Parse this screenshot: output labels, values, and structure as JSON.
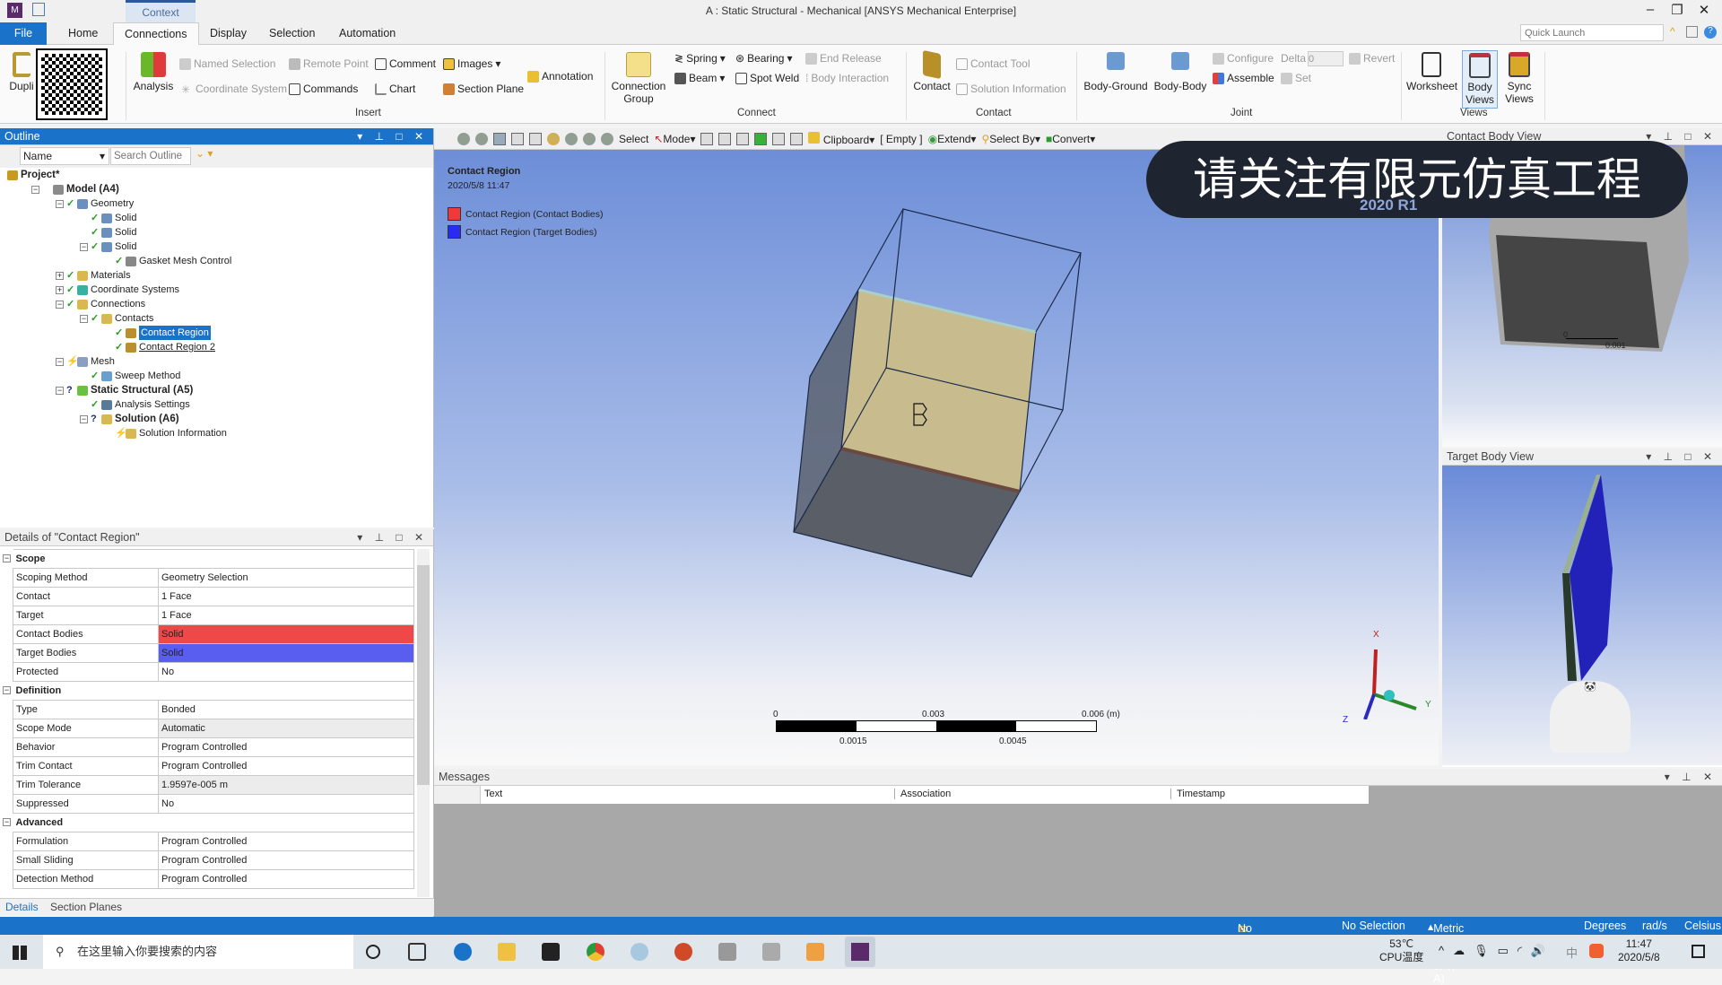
{
  "titlebar": {
    "context_tab": "Context",
    "title": "A : Static Structural - Mechanical [ANSYS Mechanical Enterprise]",
    "minimize": "–",
    "restore": "❐",
    "close": "✕",
    "quick_launch_placeholder": "Quick Launch"
  },
  "tabs": [
    "File",
    "Home",
    "Connections",
    "Display",
    "Selection",
    "Automation"
  ],
  "ribbon": {
    "duplicate": "Dupli",
    "insert_items": {
      "analysis": "Analysis",
      "named_selection": "Named Selection",
      "remote_point": "Remote Point",
      "comment": "Comment",
      "images": "Images",
      "coordinate_system": "Coordinate System",
      "commands": "Commands",
      "chart": "Chart",
      "section_plane": "Section Plane",
      "annotation": "Annotation"
    },
    "insert_group": "Insert",
    "connect": {
      "connection_group": "Connection Group",
      "spring": "Spring",
      "bearing": "Bearing",
      "end_release": "End Release",
      "beam": "Beam",
      "spot_weld": "Spot Weld",
      "body_interaction": "Body Interaction"
    },
    "connect_group": "Connect",
    "contact": {
      "contact": "Contact",
      "contact_tool": "Contact Tool",
      "solution_information": "Solution Information"
    },
    "contact_group": "Contact",
    "joint": {
      "body_ground": "Body-Ground",
      "body_body": "Body-Body",
      "configure": "Configure",
      "delta": "Delta",
      "delta_value": "0",
      "revert": "Revert",
      "assemble": "Assemble",
      "set": "Set"
    },
    "joint_group": "Joint",
    "views": {
      "worksheet": "Worksheet",
      "body_views": "Body Views",
      "sync_views": "Sync Views"
    },
    "views_group": "Views"
  },
  "outline": {
    "title": "Outline",
    "filter": "Name",
    "search_placeholder": "Search Outline",
    "tree": [
      {
        "label": "Project*",
        "bold": true
      },
      {
        "label": "Model (A4)",
        "bold": true
      },
      {
        "label": "Geometry"
      },
      {
        "label": "Solid"
      },
      {
        "label": "Solid"
      },
      {
        "label": "Solid"
      },
      {
        "label": "Gasket Mesh Control"
      },
      {
        "label": "Materials"
      },
      {
        "label": "Coordinate Systems"
      },
      {
        "label": "Connections"
      },
      {
        "label": "Contacts"
      },
      {
        "label": "Contact Region",
        "selected": true
      },
      {
        "label": "Contact Region 2"
      },
      {
        "label": "Mesh"
      },
      {
        "label": "Sweep Method"
      },
      {
        "label": "Static Structural (A5)",
        "bold": true
      },
      {
        "label": "Analysis Settings"
      },
      {
        "label": "Solution (A6)",
        "bold": true
      },
      {
        "label": "Solution Information"
      }
    ]
  },
  "details": {
    "title": "Details of \"Contact Region\"",
    "sections": [
      {
        "name": "Scope",
        "rows": [
          [
            "Scoping Method",
            "Geometry Selection"
          ],
          [
            "Contact",
            "1 Face"
          ],
          [
            "Target",
            "1 Face"
          ],
          [
            "Contact Bodies",
            "Solid"
          ],
          [
            "Target Bodies",
            "Solid"
          ],
          [
            "Protected",
            "No"
          ]
        ]
      },
      {
        "name": "Definition",
        "rows": [
          [
            "Type",
            "Bonded"
          ],
          [
            "Scope Mode",
            "Automatic"
          ],
          [
            "Behavior",
            "Program Controlled"
          ],
          [
            "Trim Contact",
            "Program Controlled"
          ],
          [
            "Trim Tolerance",
            "1.9597e-005 m"
          ],
          [
            "Suppressed",
            "No"
          ]
        ]
      },
      {
        "name": "Advanced",
        "rows": [
          [
            "Formulation",
            "Program Controlled"
          ],
          [
            "Small Sliding",
            "Program Controlled"
          ],
          [
            "Detection Method",
            "Program Controlled"
          ]
        ]
      }
    ],
    "tabs": [
      "Details",
      "Section Planes"
    ],
    "colors": {
      "contact": "#f04848",
      "target": "#5a5ef0"
    }
  },
  "graphics_toolbar": {
    "select": "Select",
    "mode": "Mode",
    "clipboard": "Clipboard",
    "empty": "[ Empty ]",
    "extend": "Extend",
    "select_by": "Select By",
    "convert": "Convert"
  },
  "viewport": {
    "title": "Contact Region",
    "date": "2020/5/8 11:47",
    "legend": [
      {
        "label": "Contact Region (Contact Bodies)",
        "color": "#f03a3a"
      },
      {
        "label": "Contact Region (Target Bodies)",
        "color": "#2a2af0"
      }
    ],
    "version": "2020 R1",
    "scale": {
      "top": [
        "0",
        "0.003",
        "0.006 (m)"
      ],
      "bottom": [
        "0.0015",
        "0.0045"
      ]
    },
    "axes": {
      "x": "X",
      "y": "Y",
      "z": "Z"
    }
  },
  "overlay_text": "请关注有限元仿真工程",
  "contact_body_view": {
    "title": "Contact Body View",
    "scale": [
      "0",
      "0.001"
    ]
  },
  "target_body_view": {
    "title": "Target Body View"
  },
  "messages": {
    "title": "Messages",
    "columns": [
      "Text",
      "Association",
      "Timestamp"
    ]
  },
  "statusbar": {
    "messages": "No Messages",
    "selection": "No Selection",
    "units": "Metric (m, kg, N, s, V, A)",
    "angle": "Degrees",
    "rotational": "rad/s",
    "temperature": "Celsius"
  },
  "taskbar": {
    "search_placeholder": "在这里输入你要搜索的内容",
    "cpu_temp": "53℃",
    "cpu_label": "CPU温度",
    "time": "11:47",
    "date": "2020/5/8",
    "ime": "中"
  }
}
